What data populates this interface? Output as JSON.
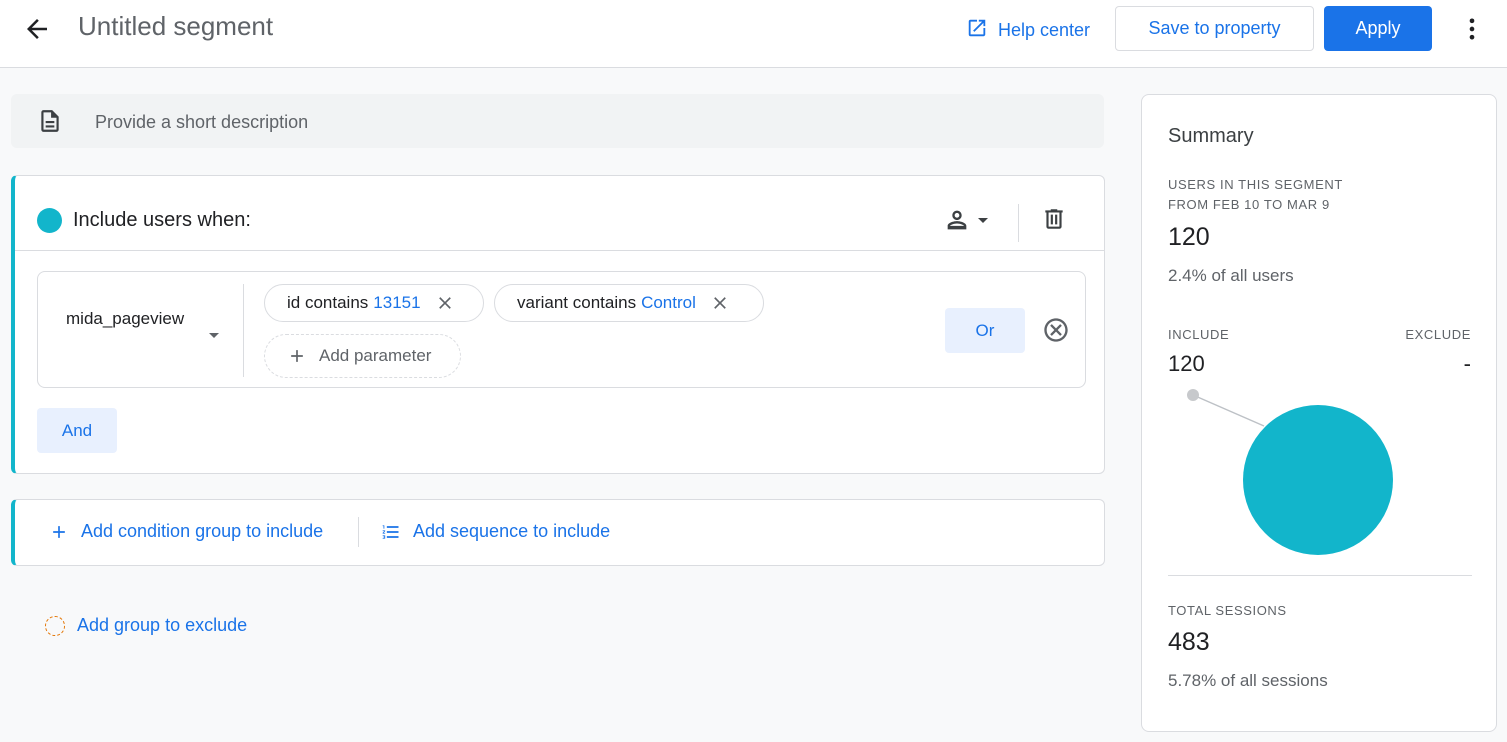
{
  "header": {
    "title": "Untitled segment",
    "help_label": "Help center",
    "save_label": "Save to property",
    "apply_label": "Apply"
  },
  "description": {
    "placeholder": "Provide a short description"
  },
  "include_group": {
    "title": "Include users when:",
    "accent_color": "#12b5cb",
    "event_name": "mida_pageview",
    "conditions": [
      {
        "field": "id contains",
        "value": "13151"
      },
      {
        "field": "variant contains",
        "value": "Control"
      }
    ],
    "add_parameter_label": "Add parameter",
    "or_label": "Or",
    "and_label": "And"
  },
  "actions": {
    "add_condition_group": "Add condition group to include",
    "add_sequence": "Add sequence to include",
    "add_exclude": "Add group to exclude"
  },
  "summary": {
    "title": "Summary",
    "users_label_line1": "USERS IN THIS SEGMENT",
    "users_label_line2": "FROM FEB 10 TO MAR 9",
    "users_count": "120",
    "users_pct": "2.4% of all users",
    "include_label": "INCLUDE",
    "exclude_label": "EXCLUDE",
    "include_value": "120",
    "exclude_value": "-",
    "sessions_label": "TOTAL SESSIONS",
    "sessions_count": "483",
    "sessions_pct": "5.78% of all sessions"
  },
  "chart_data": {
    "type": "pie",
    "categories": [
      "INCLUDE",
      "EXCLUDE"
    ],
    "values": [
      120,
      0
    ],
    "colors": [
      "#12b5cb",
      "#bdc1c6"
    ]
  },
  "colors": {
    "primary": "#1a73e8",
    "teal": "#12b5cb"
  }
}
